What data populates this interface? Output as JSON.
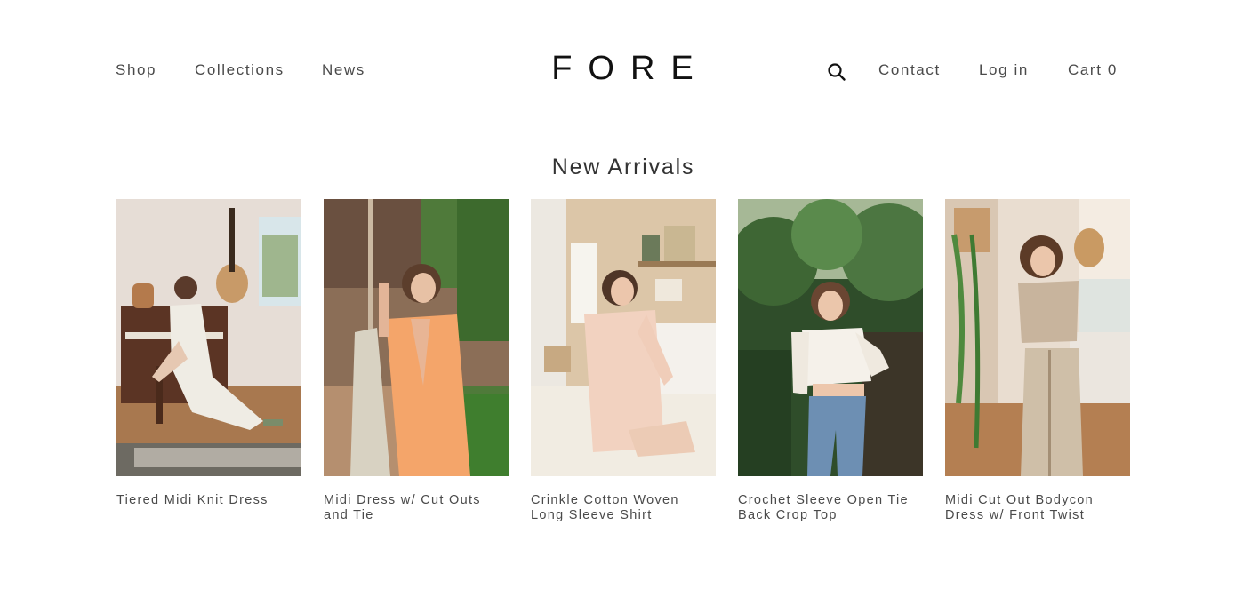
{
  "header": {
    "nav_left": [
      "Shop",
      "Collections",
      "News"
    ],
    "logo": "FORE",
    "nav_right": {
      "contact": "Contact",
      "login": "Log in",
      "cart": "Cart 0"
    },
    "search_icon": "search-icon"
  },
  "section": {
    "title": "New Arrivals"
  },
  "products": [
    {
      "title": "Tiered Midi Knit Dress"
    },
    {
      "title": "Midi Dress w/ Cut Outs and Tie"
    },
    {
      "title": "Crinkle Cotton Woven Long Sleeve Shirt"
    },
    {
      "title": "Crochet Sleeve Open Tie Back Crop Top"
    },
    {
      "title": "Midi Cut Out Bodycon Dress w/ Front Twist"
    }
  ]
}
